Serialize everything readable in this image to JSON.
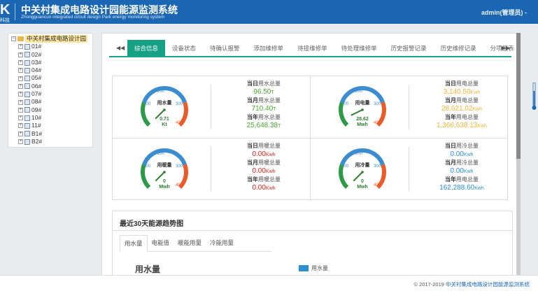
{
  "header": {
    "logo": "K",
    "logo_sub": "科技",
    "title": "中关村集成电路设计园能源监测系统",
    "subtitle": "Zhongguancun integrated circuit design Park energy monitoring system",
    "user": "admin(管理员) -"
  },
  "tree": {
    "root": "中关村集成电路设计园",
    "items": [
      "01#",
      "02#",
      "03#",
      "04#",
      "05#",
      "06#",
      "07#",
      "08#",
      "09#",
      "10#",
      "11#",
      "B1#",
      "B2#"
    ]
  },
  "tabs": [
    "综合信息",
    "设备状态",
    "待确认报警",
    "添加维修单",
    "待接维修单",
    "待处理维修单",
    "历史报警记录",
    "历史维修记录",
    "分项报表"
  ],
  "gauges": [
    {
      "name": "用水量",
      "value": "0.71",
      "unit": "Kt",
      "scale": [
        "0",
        "100",
        "200",
        "300",
        "400"
      ],
      "stats": [
        {
          "label": "当日",
          "suffix": "用水总量",
          "value": "96.50",
          "unit": "T"
        },
        {
          "label": "当月",
          "suffix": "用水总量",
          "value": "710.40",
          "unit": "T"
        },
        {
          "label": "当年",
          "suffix": "用水总量",
          "value": "25,648.38",
          "unit": "T"
        }
      ],
      "color": "#4aa52e"
    },
    {
      "name": "用电量",
      "value": "28.62",
      "unit": "Mwh",
      "scale": [
        "0",
        "100",
        "200",
        "300",
        "400"
      ],
      "stats": [
        {
          "label": "当日",
          "suffix": "用电总量",
          "value": "3,140.50",
          "unit": "Kwh"
        },
        {
          "label": "当月",
          "suffix": "用电总量",
          "value": "28,621.02",
          "unit": "Kwh"
        },
        {
          "label": "当年",
          "suffix": "用电总量",
          "value": "1,366,638.13",
          "unit": "Kwh"
        }
      ],
      "color": "#f0b43c"
    },
    {
      "name": "用暖量",
      "value": "0",
      "unit": "Mwh",
      "scale": [
        "0",
        "100",
        "200",
        "300",
        "400"
      ],
      "stats": [
        {
          "label": "当日",
          "suffix": "用暖总量",
          "value": "0.00",
          "unit": "Kwh"
        },
        {
          "label": "当月",
          "suffix": "用暖总量",
          "value": "0.00",
          "unit": "Kwh"
        },
        {
          "label": "当年",
          "suffix": "用暖总量",
          "value": "0.00",
          "unit": "Kwh"
        }
      ],
      "color": "#d9261c"
    },
    {
      "name": "用冷量",
      "value": "0",
      "unit": "Mwh",
      "scale": [
        "0",
        "100",
        "200",
        "300",
        "400"
      ],
      "stats": [
        {
          "label": "当日",
          "suffix": "用冷总量",
          "value": "0.00",
          "unit": "Kwh"
        },
        {
          "label": "当月",
          "suffix": "用冷总量",
          "value": "0.00",
          "unit": "Kwh"
        },
        {
          "label": "当年",
          "suffix": "用电总量",
          "value": "162,288.60",
          "unit": "Kwh"
        }
      ],
      "color": "#2b8fd1"
    }
  ],
  "trend": {
    "title": "最近30天能源趋势图",
    "tabs": [
      "用水量",
      "电能值",
      "暖能用量",
      "冷能用量"
    ],
    "y_title": "用水量",
    "legend": "用水量",
    "legend_color": "#2b8fd1"
  },
  "footer": {
    "copyright": "© 2017-2019 ",
    "org": "中关村集成电路设计园能源监测系统"
  }
}
